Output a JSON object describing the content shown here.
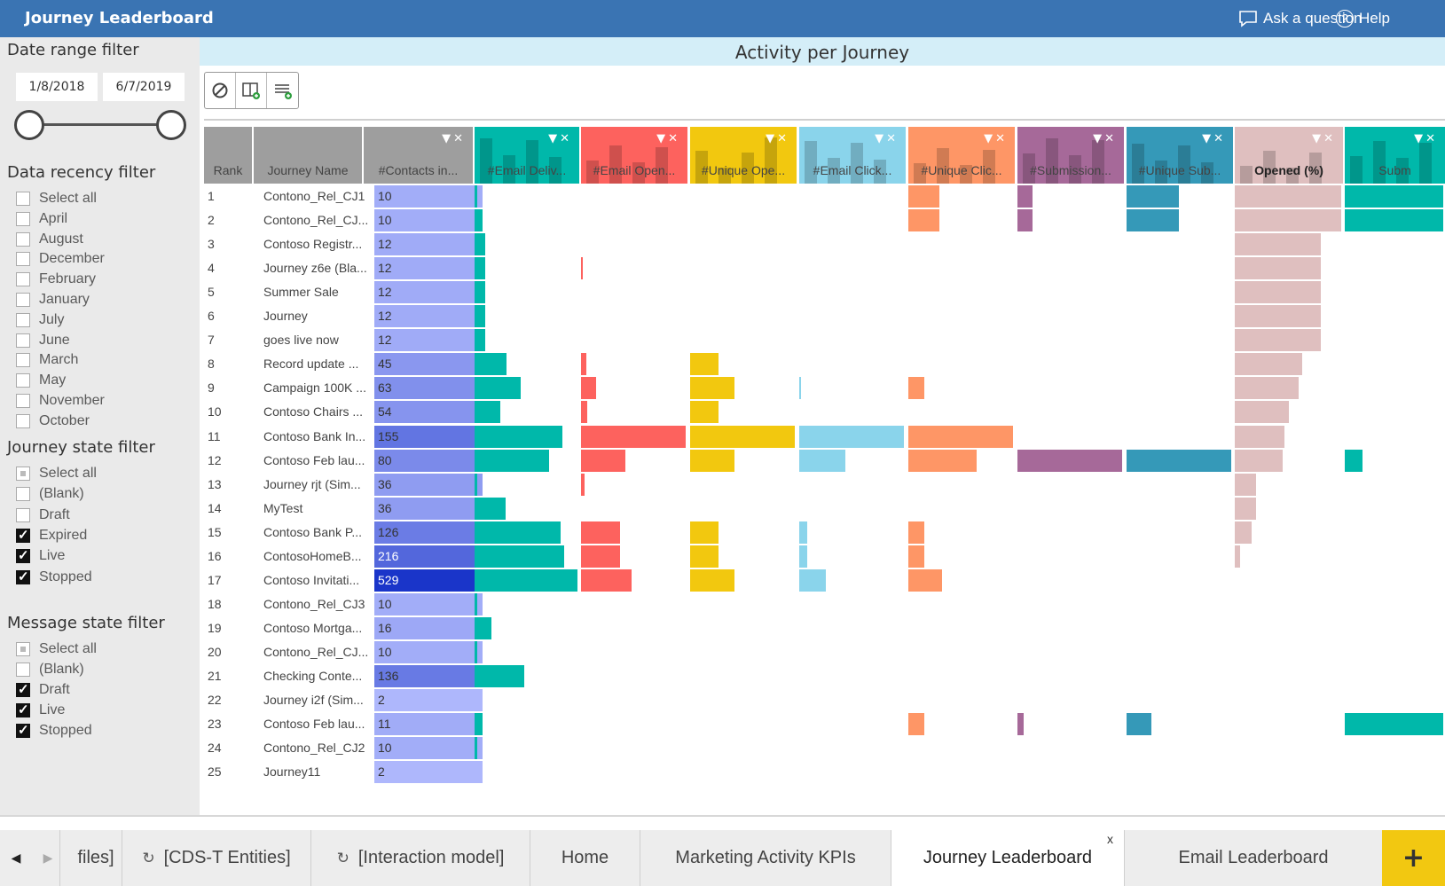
{
  "titlebar": {
    "title": "Journey Leaderboard",
    "ask_label": "Ask a question",
    "help_label": "Help"
  },
  "filters": {
    "date_range": {
      "title": "Date range filter",
      "start": "1/8/2018",
      "end": "6/7/2019"
    },
    "data_recency": {
      "title": "Data recency filter",
      "items": [
        {
          "label": "Select all",
          "checked": false
        },
        {
          "label": "April",
          "checked": false
        },
        {
          "label": "August",
          "checked": false
        },
        {
          "label": "December",
          "checked": false
        },
        {
          "label": "February",
          "checked": false
        },
        {
          "label": "January",
          "checked": false
        },
        {
          "label": "July",
          "checked": false
        },
        {
          "label": "June",
          "checked": false
        },
        {
          "label": "March",
          "checked": false
        },
        {
          "label": "May",
          "checked": false
        },
        {
          "label": "November",
          "checked": false
        },
        {
          "label": "October",
          "checked": false
        }
      ]
    },
    "journey_state": {
      "title": "Journey state filter",
      "items": [
        {
          "label": "Select all",
          "checked": "partial"
        },
        {
          "label": "(Blank)",
          "checked": false
        },
        {
          "label": "Draft",
          "checked": false
        },
        {
          "label": "Expired",
          "checked": true
        },
        {
          "label": "Live",
          "checked": true
        },
        {
          "label": "Stopped",
          "checked": true
        }
      ]
    },
    "message_state": {
      "title": "Message state filter",
      "items": [
        {
          "label": "Select all",
          "checked": "partial"
        },
        {
          "label": "(Blank)",
          "checked": false
        },
        {
          "label": "Draft",
          "checked": true
        },
        {
          "label": "Live",
          "checked": true
        },
        {
          "label": "Stopped",
          "checked": true
        }
      ]
    }
  },
  "visual": {
    "title": "Activity per Journey",
    "toolbar_icons": [
      "clear-filter-icon",
      "add-column-icon",
      "add-row-icon"
    ]
  },
  "table": {
    "columns": [
      {
        "label": "Rank",
        "color": "#9e9e9e"
      },
      {
        "label": "Journey Name",
        "color": "#9e9e9e"
      },
      {
        "label": "#Contacts in...",
        "color": "#9e9e9e"
      },
      {
        "label": "#Email Deliv...",
        "color": "#00b8aa"
      },
      {
        "label": "#Email Open...",
        "color": "#fd625e"
      },
      {
        "label": "#Unique Ope...",
        "color": "#f2c80f"
      },
      {
        "label": "#Email Click...",
        "color": "#8ad4eb"
      },
      {
        "label": "#Unique Clic...",
        "color": "#fe9666"
      },
      {
        "label": "#Submission...",
        "color": "#a66999"
      },
      {
        "label": "#Unique Sub...",
        "color": "#3599b8"
      },
      {
        "label": "Opened (%)",
        "color": "#dfbfbf"
      },
      {
        "label": "Subm",
        "color": "#00b8aa"
      }
    ],
    "rows": [
      {
        "rank": "1",
        "name": "Contono_Rel_CJ1",
        "contacts": 10,
        "email_deliv": 3,
        "email_open": 0,
        "unique_open": 0,
        "email_click": 0,
        "unique_click": 30,
        "submission": 14,
        "unique_sub": 50,
        "opened_pct": 100,
        "subm": 100
      },
      {
        "rank": "2",
        "name": "Contono_Rel_CJ...",
        "contacts": 10,
        "email_deliv": 8,
        "email_open": 0,
        "unique_open": 0,
        "email_click": 0,
        "unique_click": 30,
        "submission": 14,
        "unique_sub": 50,
        "opened_pct": 100,
        "subm": 100
      },
      {
        "rank": "3",
        "name": "Contoso Registr...",
        "contacts": 12,
        "email_deliv": 10,
        "email_open": 0,
        "unique_open": 0,
        "email_click": 0,
        "unique_click": 0,
        "submission": 0,
        "unique_sub": 0,
        "opened_pct": 81,
        "subm": 0
      },
      {
        "rank": "4",
        "name": "Journey z6e (Bla...",
        "contacts": 12,
        "email_deliv": 10,
        "email_open": 1,
        "unique_open": 0,
        "email_click": 0,
        "unique_click": 0,
        "submission": 0,
        "unique_sub": 0,
        "opened_pct": 81,
        "subm": 0
      },
      {
        "rank": "5",
        "name": "Summer Sale",
        "contacts": 12,
        "email_deliv": 10,
        "email_open": 0,
        "unique_open": 0,
        "email_click": 0,
        "unique_click": 0,
        "submission": 0,
        "unique_sub": 0,
        "opened_pct": 81,
        "subm": 0
      },
      {
        "rank": "6",
        "name": "Journey",
        "contacts": 12,
        "email_deliv": 10,
        "email_open": 0,
        "unique_open": 0,
        "email_click": 0,
        "unique_click": 0,
        "submission": 0,
        "unique_sub": 0,
        "opened_pct": 81,
        "subm": 0
      },
      {
        "rank": "7",
        "name": "goes live now",
        "contacts": 12,
        "email_deliv": 10,
        "email_open": 0,
        "unique_open": 0,
        "email_click": 0,
        "unique_click": 0,
        "submission": 0,
        "unique_sub": 0,
        "opened_pct": 81,
        "subm": 0
      },
      {
        "rank": "8",
        "name": "Record update ...",
        "contacts": 45,
        "email_deliv": 31,
        "email_open": 5,
        "unique_open": 27,
        "email_click": 0,
        "unique_click": 0,
        "submission": 0,
        "unique_sub": 0,
        "opened_pct": 63,
        "subm": 0
      },
      {
        "rank": "9",
        "name": "Campaign 100K ...",
        "contacts": 63,
        "email_deliv": 45,
        "email_open": 14,
        "unique_open": 42,
        "email_click": 1,
        "unique_click": 15,
        "submission": 0,
        "unique_sub": 0,
        "opened_pct": 60,
        "subm": 0
      },
      {
        "rank": "10",
        "name": "Contoso Chairs ...",
        "contacts": 54,
        "email_deliv": 25,
        "email_open": 6,
        "unique_open": 27,
        "email_click": 0,
        "unique_click": 0,
        "submission": 0,
        "unique_sub": 0,
        "opened_pct": 51,
        "subm": 0
      },
      {
        "rank": "11",
        "name": "Contoso Bank In...",
        "contacts": 155,
        "email_deliv": 85,
        "email_open": 100,
        "unique_open": 100,
        "email_click": 100,
        "unique_click": 100,
        "submission": 0,
        "unique_sub": 0,
        "opened_pct": 47,
        "subm": 0
      },
      {
        "rank": "12",
        "name": "Contoso Feb lau...",
        "contacts": 80,
        "email_deliv": 72,
        "email_open": 42,
        "unique_open": 42,
        "email_click": 44,
        "unique_click": 65,
        "submission": 100,
        "unique_sub": 100,
        "opened_pct": 45,
        "subm": 18
      },
      {
        "rank": "13",
        "name": "Journey rjt (Sim...",
        "contacts": 36,
        "email_deliv": 3,
        "email_open": 3,
        "unique_open": 0,
        "email_click": 0,
        "unique_click": 0,
        "submission": 0,
        "unique_sub": 0,
        "opened_pct": 20,
        "subm": 0
      },
      {
        "rank": "14",
        "name": "MyTest",
        "contacts": 36,
        "email_deliv": 30,
        "email_open": 0,
        "unique_open": 0,
        "email_click": 0,
        "unique_click": 0,
        "submission": 0,
        "unique_sub": 0,
        "opened_pct": 20,
        "subm": 0
      },
      {
        "rank": "15",
        "name": "Contoso Bank P...",
        "contacts": 126,
        "email_deliv": 84,
        "email_open": 37,
        "unique_open": 27,
        "email_click": 8,
        "unique_click": 15,
        "submission": 0,
        "unique_sub": 0,
        "opened_pct": 16,
        "subm": 0
      },
      {
        "rank": "16",
        "name": "ContosoHomeB...",
        "contacts": 216,
        "email_deliv": 87,
        "email_open": 37,
        "unique_open": 27,
        "email_click": 8,
        "unique_click": 15,
        "submission": 0,
        "unique_sub": 0,
        "opened_pct": 5,
        "subm": 0
      },
      {
        "rank": "17",
        "name": "Contoso Invitati...",
        "contacts": 529,
        "email_deliv": 100,
        "email_open": 48,
        "unique_open": 42,
        "email_click": 25,
        "unique_click": 32,
        "submission": 0,
        "unique_sub": 0,
        "opened_pct": 0,
        "subm": 0
      },
      {
        "rank": "18",
        "name": "Contono_Rel_CJ3",
        "contacts": 10,
        "email_deliv": 3,
        "email_open": 0,
        "unique_open": 0,
        "email_click": 0,
        "unique_click": 0,
        "submission": 0,
        "unique_sub": 0,
        "opened_pct": 0,
        "subm": 0
      },
      {
        "rank": "19",
        "name": "Contoso Mortga...",
        "contacts": 16,
        "email_deliv": 16,
        "email_open": 0,
        "unique_open": 0,
        "email_click": 0,
        "unique_click": 0,
        "submission": 0,
        "unique_sub": 0,
        "opened_pct": 0,
        "subm": 0
      },
      {
        "rank": "20",
        "name": "Contono_Rel_CJ...",
        "contacts": 10,
        "email_deliv": 3,
        "email_open": 0,
        "unique_open": 0,
        "email_click": 0,
        "unique_click": 0,
        "submission": 0,
        "unique_sub": 0,
        "opened_pct": 0,
        "subm": 0
      },
      {
        "rank": "21",
        "name": "Checking Conte...",
        "contacts": 136,
        "email_deliv": 48,
        "email_open": 0,
        "unique_open": 0,
        "email_click": 0,
        "unique_click": 0,
        "submission": 0,
        "unique_sub": 0,
        "opened_pct": 0,
        "subm": 0
      },
      {
        "rank": "22",
        "name": "Journey i2f (Sim...",
        "contacts": 2,
        "email_deliv": 0,
        "email_open": 0,
        "unique_open": 0,
        "email_click": 0,
        "unique_click": 0,
        "submission": 0,
        "unique_sub": 0,
        "opened_pct": 0,
        "subm": 0
      },
      {
        "rank": "23",
        "name": "Contoso Feb lau...",
        "contacts": 11,
        "email_deliv": 8,
        "email_open": 0,
        "unique_open": 0,
        "email_click": 0,
        "unique_click": 15,
        "submission": 6,
        "unique_sub": 24,
        "opened_pct": 0,
        "subm": 100
      },
      {
        "rank": "24",
        "name": "Contono_Rel_CJ2",
        "contacts": 10,
        "email_deliv": 3,
        "email_open": 0,
        "unique_open": 0,
        "email_click": 0,
        "unique_click": 0,
        "submission": 0,
        "unique_sub": 0,
        "opened_pct": 0,
        "subm": 0
      },
      {
        "rank": "25",
        "name": "Journey11",
        "contacts": 2,
        "email_deliv": 0,
        "email_open": 0,
        "unique_open": 0,
        "email_click": 0,
        "unique_click": 0,
        "submission": 0,
        "unique_sub": 0,
        "opened_pct": 0,
        "subm": 0
      }
    ]
  },
  "tabs": {
    "items": [
      {
        "label": "  files]",
        "icon": "",
        "active": false
      },
      {
        "label": "[CDS-T Entities]",
        "icon": "refresh-icon",
        "active": false
      },
      {
        "label": "[Interaction model]",
        "icon": "refresh-icon",
        "active": false
      },
      {
        "label": "Home",
        "icon": "",
        "active": false
      },
      {
        "label": "Marketing Activity KPIs",
        "icon": "",
        "active": false
      },
      {
        "label": "Journey Leaderboard",
        "icon": "",
        "active": true
      },
      {
        "label": "Email Leaderboard",
        "icon": "",
        "active": false
      }
    ],
    "close_label": "x",
    "add_label": "+"
  },
  "colors": {
    "titlebar": "#3a74b3",
    "contacts_light": "#b8c0ff",
    "contacts_dark": "#1a35c9",
    "add_tab": "#f2c811"
  }
}
